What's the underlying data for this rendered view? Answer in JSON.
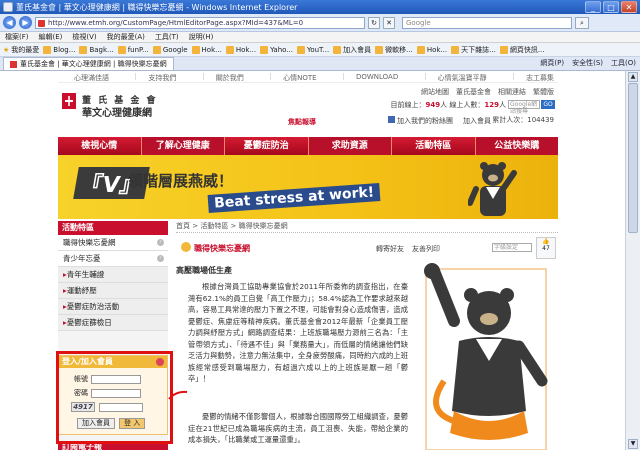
{
  "window": {
    "title": "董氏基金會 | 華文心理健康網 | 職得快樂忘憂網 - Windows Internet Explorer",
    "url": "http://www.etmh.org/CustomPage/HtmlEditorPage.aspx?MId=437&ML=0",
    "search_placeholder": "Google"
  },
  "menubar": [
    "檔案(F)",
    "編輯(E)",
    "檢視(V)",
    "我的最愛(A)",
    "工具(T)",
    "說明(H)"
  ],
  "favorites": [
    "我的最愛",
    "Blog...",
    "Bagk...",
    "funP...",
    "Google",
    "Hok...",
    "Hok...",
    "Yaho...",
    "YouT...",
    "加入會員",
    "微軟移...",
    "Hok...",
    "天下雜誌...",
    "網頁快訊..."
  ],
  "tab": {
    "label": "董氏基金會 | 華文心理健康網 | 職得快樂忘憂網"
  },
  "commandbar": [
    "網頁(P)",
    "安全性(S)",
    "工具(O)"
  ],
  "site": {
    "topnav": [
      "心理滿佳語",
      "支持我們",
      "關於我們",
      "心情NOTE",
      "DOWNLOAD",
      "心情氣溫寶平靜",
      "志工募集"
    ],
    "util_links": [
      "網站地圖",
      "董氏基金會",
      "相關連結",
      "繁體版"
    ],
    "logo_line1": "董 氏 基 金 會",
    "logo_line2": "華文心理健康網",
    "stats": {
      "today_label": "目前線上：",
      "today": "949",
      "unit": "人",
      "online_label": "線上人數：",
      "online": "129",
      "total_label": "累計人次：",
      "total": "104439"
    },
    "gsearch_placeholder": "Google網站搜尋",
    "go_label": "GO",
    "focus": "焦點報導",
    "fb_links": [
      "加入我們的粉絲團",
      "加入會員"
    ],
    "mainnav": [
      "檢視心情",
      "了解心理健康",
      "憂鬱症防治",
      "求助資源",
      "活動特區",
      "公益快樂購"
    ],
    "banner": {
      "v": "『V』",
      "tag1": "領階層展燕威！",
      "tag2": "Beat stress at work!"
    },
    "sidebar": {
      "header": "活動特區",
      "items": [
        "職得快樂忘憂網",
        "青少年忘憂",
        "青年生輔證",
        "運動紓壓",
        "憂鬱症防治活動",
        "憂鬱症篩檢日"
      ],
      "member": {
        "title": "登入/加入會員",
        "account": "帳號",
        "password": "密碼",
        "captcha": "4917",
        "join": "加入會員",
        "login": "登 入"
      },
      "newsletter": "訂閱電子報"
    },
    "content": {
      "breadcrumb": "首頁 > 活動特區 > 職得快樂忘憂網",
      "name": "職得快樂忘憂網",
      "tools": [
        "轉寄好友",
        "友善列印"
      ],
      "select": "字級設定",
      "like_count": "47",
      "headline": "高壓職場低生產",
      "para1": "根據台灣員工協助專業協會於2011年所委佈的調查指出，在臺灣有62.1%的員工自覺「高工作壓力」；58.4%認為工作要求越來越高，容易工具常達的壓力下置之不理，可能會對身心造成傷害，造成憂鬱症、焦慮症等精神疾病。董氏基金會2012年最新「企業員工壓力調與紓壓方式」網路調查結果：上班族職場壓力源前三名為：「主管帶領方式」、「待遇不佳」與「業務量大」，而低層的情緒讓他們缺乏活力與動勢，注意力無法集中，全身疲勞酸痛，同時約六成的上班族經常感受到職場壓力，有超過六成以上的上班族是厭一趟「鬱卒」！",
      "para2": "憂鬱的情緒不僅影響個人，根據聯合國國際勞工組織調查，憂鬱症在21世紀已成為職場疾病的主流，員工沮喪、失能，帶給企業的成本損失，「比職業或工運量還重」。"
    }
  }
}
